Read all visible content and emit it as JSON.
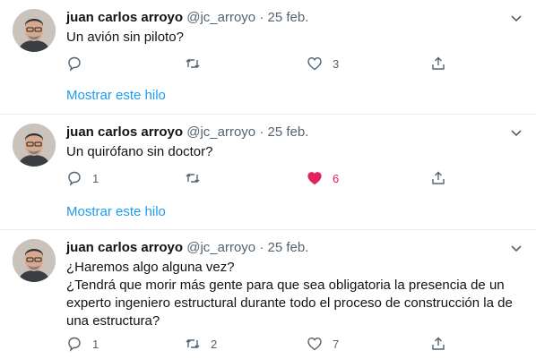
{
  "tweets": [
    {
      "name": "juan carlos arroyo",
      "handle": "@jc_arroyo",
      "dot": "·",
      "date": "25 feb.",
      "lines": [
        "Un avión sin piloto?"
      ],
      "reply_count": "",
      "retweet_count": "",
      "like_count": "3",
      "liked": false,
      "show_thread": "Mostrar este hilo"
    },
    {
      "name": "juan carlos arroyo",
      "handle": "@jc_arroyo",
      "dot": "·",
      "date": "25 feb.",
      "lines": [
        "Un quirófano sin doctor?"
      ],
      "reply_count": "1",
      "retweet_count": "",
      "like_count": "6",
      "liked": true,
      "show_thread": "Mostrar este hilo"
    },
    {
      "name": "juan carlos arroyo",
      "handle": "@jc_arroyo",
      "dot": "·",
      "date": "25 feb.",
      "lines": [
        "¿Haremos algo alguna vez?",
        "¿Tendrá que morir más gente para que sea obligatoria la presencia de un",
        "experto ingeniero estructural durante todo el proceso de construcción la de",
        "una estructura?"
      ],
      "reply_count": "1",
      "retweet_count": "2",
      "like_count": "7",
      "liked": false,
      "show_thread": ""
    }
  ],
  "colors": {
    "accent": "#1d9bf0",
    "like_active": "#e0245e",
    "muted": "#536471",
    "divider": "#e6ecf0"
  }
}
